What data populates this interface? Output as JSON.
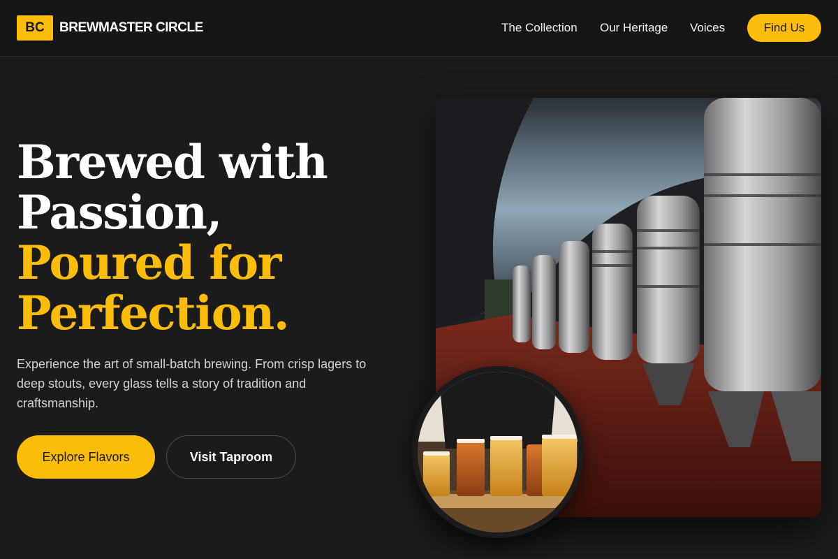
{
  "brand": {
    "badge": "BC",
    "name": "BREWMASTER CIRCLE"
  },
  "nav": {
    "items": [
      {
        "label": "The Collection"
      },
      {
        "label": "Our Heritage"
      },
      {
        "label": "Voices"
      }
    ],
    "cta_label": "Find Us"
  },
  "hero": {
    "headline_line1": "Brewed with",
    "headline_line2": "Passion,",
    "headline_line3": "Poured for",
    "headline_line4": "Perfection.",
    "description": "Experience the art of small-batch brewing. From crisp lagers to deep stouts, every glass tells a story of tradition and craftsmanship.",
    "primary_button": "Explore Flavors",
    "secondary_button": "Visit Taproom"
  },
  "colors": {
    "accent": "#fbbd0a",
    "background": "#1b1b1c",
    "header_bg": "#161617"
  },
  "images": {
    "main": "brewery-fermentation-tanks-photo",
    "inset": "beer-flight-tasting-photo"
  }
}
